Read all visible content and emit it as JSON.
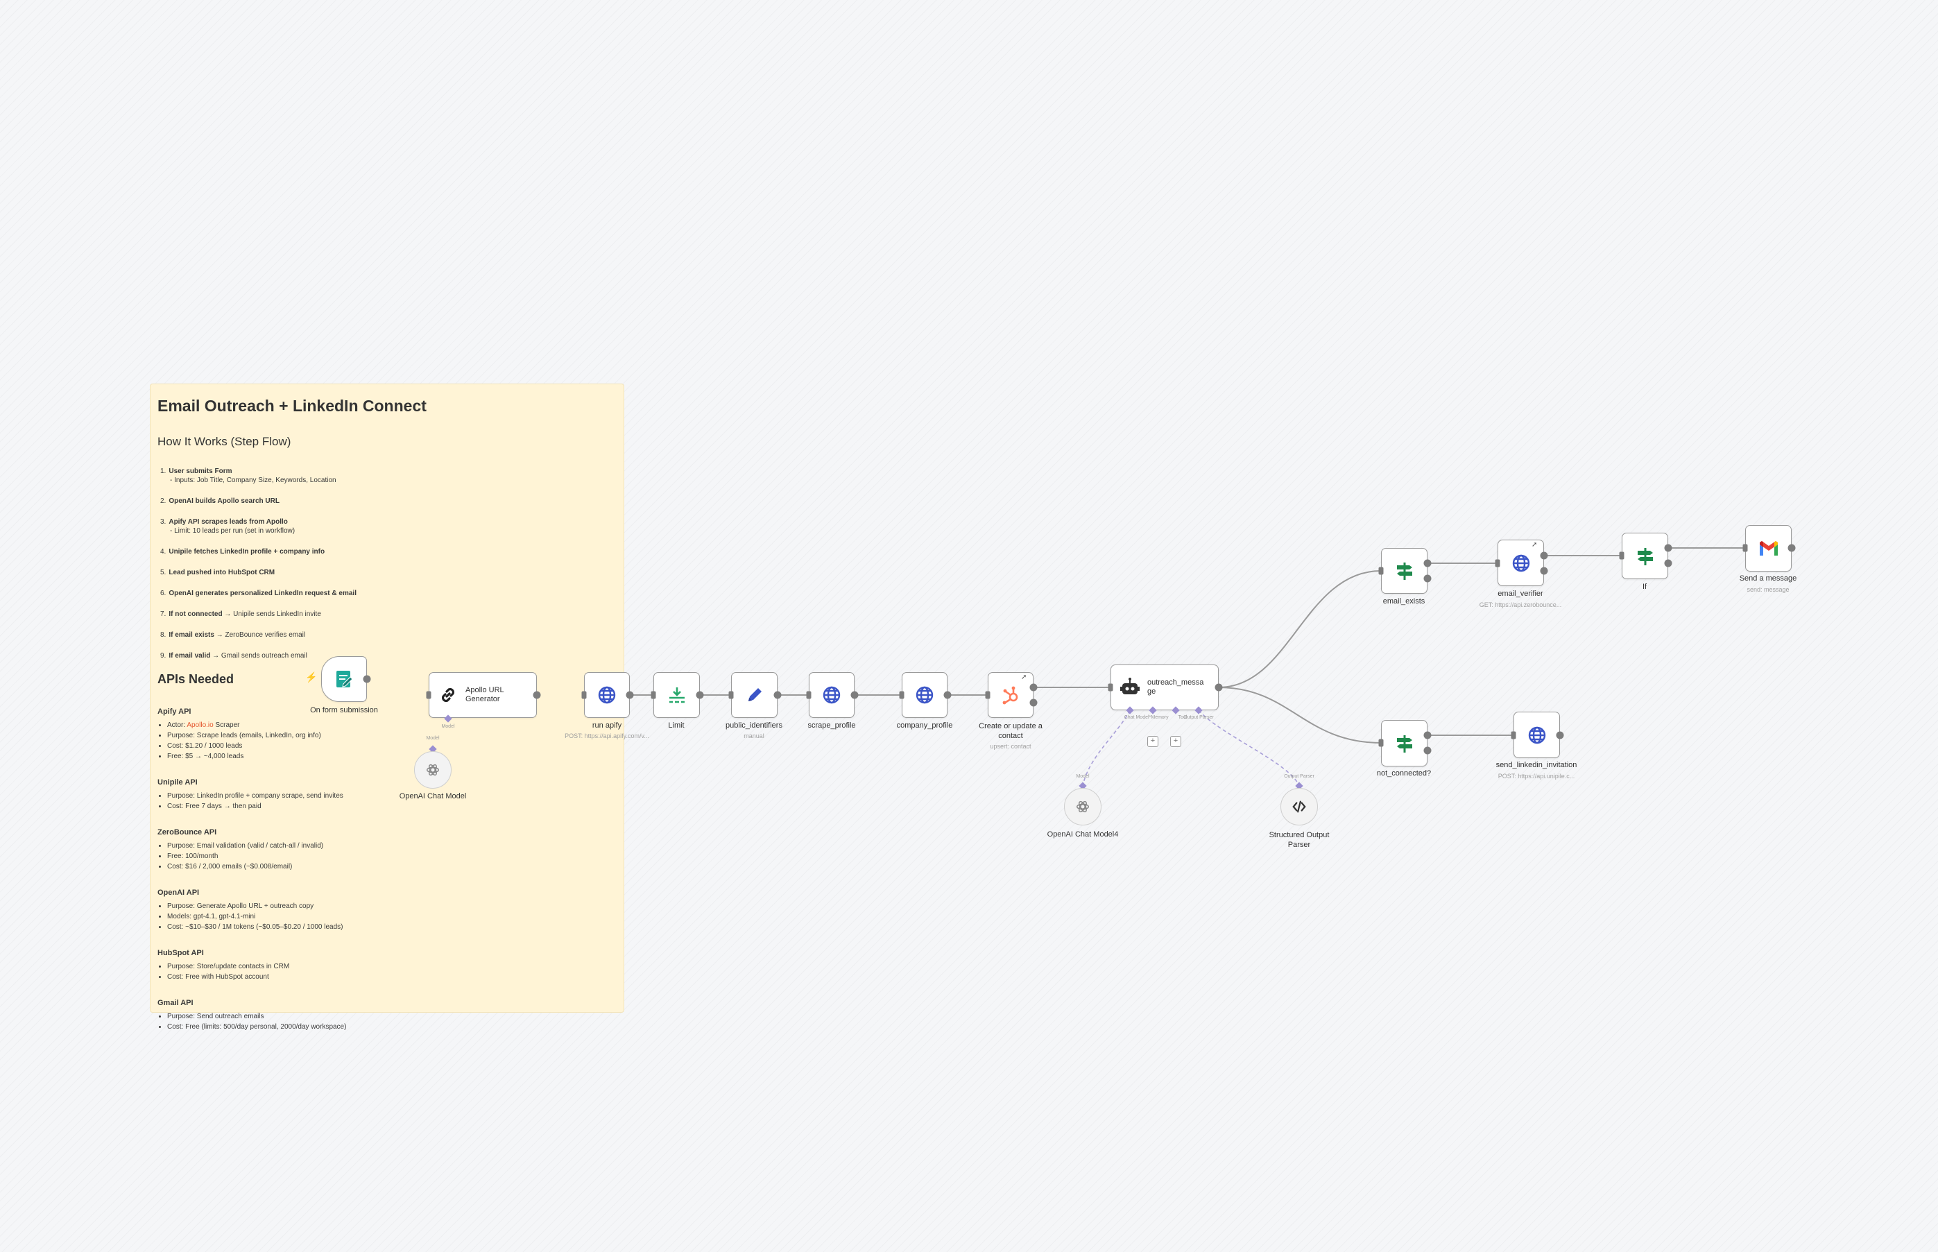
{
  "note": {
    "title": "Email Outreach + LinkedIn Connect",
    "how_title": "How It Works (Step Flow)",
    "steps": [
      {
        "num": "1.",
        "bold": "User submits Form",
        "text": "",
        "sub": "- Inputs: Job Title, Company Size, Keywords, Location"
      },
      {
        "num": "2.",
        "bold": "OpenAI builds Apollo search URL",
        "text": "",
        "sub": ""
      },
      {
        "num": "3.",
        "bold": "Apify API scrapes leads from Apollo",
        "text": "",
        "sub": "- Limit: 10 leads per run (set in workflow)"
      },
      {
        "num": "4.",
        "bold": "Unipile fetches LinkedIn profile + company info",
        "text": "",
        "sub": ""
      },
      {
        "num": "5.",
        "bold": "Lead pushed into HubSpot CRM",
        "text": "",
        "sub": ""
      },
      {
        "num": "6.",
        "bold": "OpenAI generates personalized LinkedIn request & email",
        "text": "",
        "sub": ""
      },
      {
        "num": "7.",
        "bold": "If not connected",
        "text": " → Unipile sends LinkedIn invite",
        "sub": ""
      },
      {
        "num": "8.",
        "bold": "If email exists",
        "text": " → ZeroBounce verifies email",
        "sub": ""
      },
      {
        "num": "9.",
        "bold": "If email valid",
        "text": " → Gmail sends outreach email",
        "sub": ""
      }
    ],
    "apis_title": "APIs Needed",
    "apify": {
      "title": "Apify API",
      "actor_prefix": "Actor: ",
      "actor_link": "Apollo.io",
      "actor_suffix": " Scraper",
      "items": [
        "Purpose: Scrape leads (emails, LinkedIn, org info)",
        "Cost: $1.20 / 1000 leads",
        "Free: $5 → ~4,000 leads"
      ]
    },
    "apis": [
      {
        "title": "Unipile API",
        "items": [
          "Purpose: LinkedIn profile + company scrape, send invites",
          "Cost: Free 7 days → then paid"
        ]
      },
      {
        "title": "ZeroBounce API",
        "items": [
          "Purpose: Email validation (valid / catch-all / invalid)",
          "Free: 100/month",
          "Cost: $16 / 2,000 emails (~$0.008/email)"
        ]
      },
      {
        "title": "OpenAI API",
        "items": [
          "Purpose: Generate Apollo URL + outreach copy",
          "Models: gpt-4.1, gpt-4.1-mini",
          "Cost: ~$10–$30 / 1M tokens (~$0.05–$0.20 / 1000 leads)"
        ]
      },
      {
        "title": "HubSpot API",
        "items": [
          "Purpose: Store/update contacts in CRM",
          "Cost: Free with HubSpot account"
        ]
      },
      {
        "title": "Gmail API",
        "items": [
          "Purpose: Send outreach emails",
          "Cost: Free (limits: 500/day personal, 2000/day workspace)"
        ]
      }
    ]
  },
  "nodes": {
    "form": {
      "label": "On form submission",
      "icon": "form-icon",
      "color": "#1fa99a"
    },
    "apollo": {
      "label1": "Apollo URL",
      "label2": "Generator",
      "icon": "link-icon"
    },
    "openai_model": {
      "label": "OpenAI Chat Model",
      "port_label": "Model"
    },
    "run_apify": {
      "label": "run apify",
      "sub": "POST: https://api.apify.com/v..."
    },
    "limit": {
      "label": "Limit"
    },
    "public_identifiers": {
      "label": "public_identifiers",
      "sub": "manual"
    },
    "scrape_profile": {
      "label": "scrape_profile"
    },
    "company_profile": {
      "label": "company_profile"
    },
    "hubspot": {
      "label1": "Create or update a",
      "label2": "contact",
      "sub": "upsert: contact"
    },
    "outreach": {
      "label1": "outreach_messa",
      "label2": "ge",
      "ports": [
        "Chat Model*",
        "Memory",
        "Tool",
        "Output Parser"
      ]
    },
    "openai_model4": {
      "label": "OpenAI Chat Model4",
      "port_label": "Model"
    },
    "parser": {
      "label1": "Structured Output",
      "label2": "Parser",
      "port_label": "Output Parser"
    },
    "email_exists": {
      "label": "email_exists"
    },
    "email_verifier": {
      "label": "email_verifier",
      "sub": "GET: https://api.zerobounce..."
    },
    "if": {
      "label": "If"
    },
    "send_message": {
      "label": "Send a message",
      "sub": "send: message"
    },
    "not_connected": {
      "label": "not_connected?"
    },
    "send_invitation": {
      "label": "send_linkedin_invitation",
      "sub": "POST: https://api.unipile.c..."
    }
  },
  "colors": {
    "globe": "#3b55c7",
    "filter": "#1f8a4c",
    "hubspot": "#ff7a59",
    "pencil": "#3b55c7",
    "limit": "#27a86c"
  }
}
